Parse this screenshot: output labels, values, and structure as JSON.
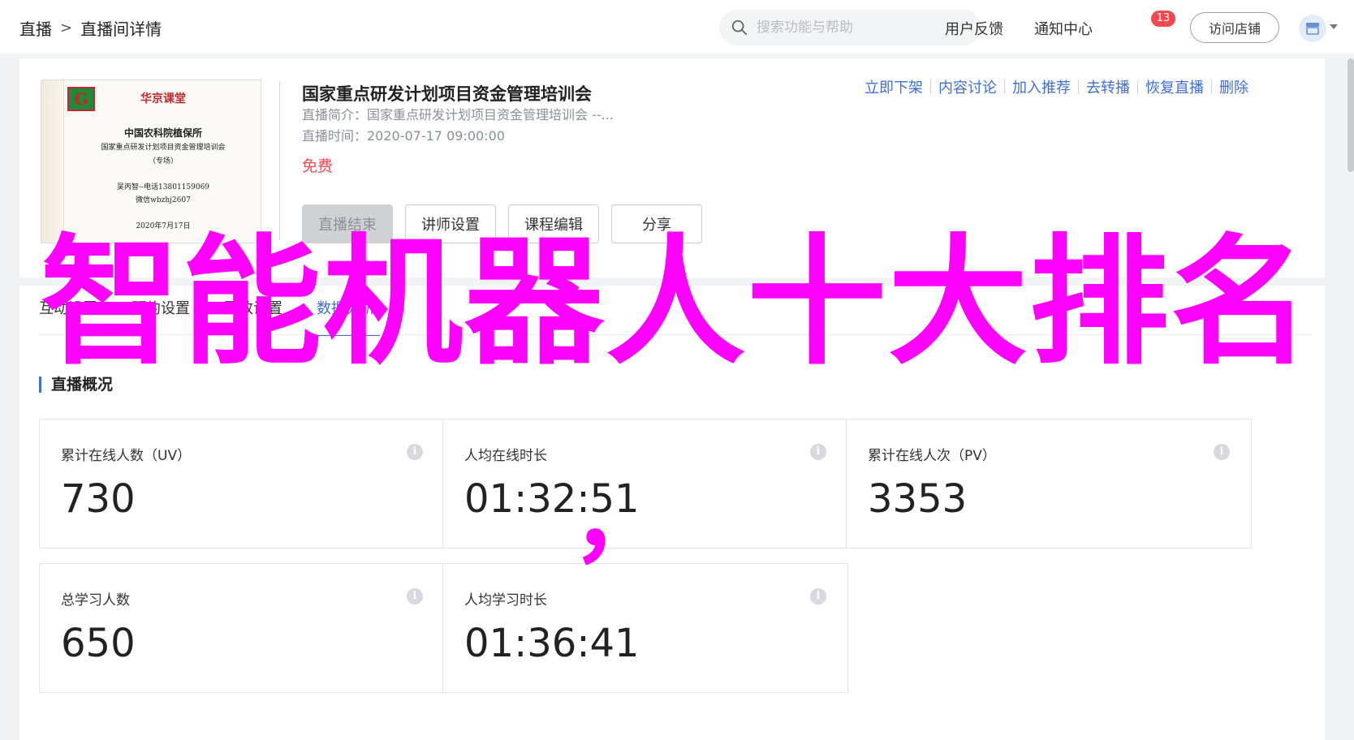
{
  "header": {
    "breadcrumb": [
      "直播",
      "直播间详情"
    ],
    "breadcrumb_sep": ">",
    "search_placeholder": "搜索功能与帮助",
    "feedback": "用户反馈",
    "notify": "通知中心",
    "notify_count": "13",
    "visit_store": "访问店铺"
  },
  "course": {
    "cover": {
      "brand": "华京课堂",
      "org": "中国农科院植保所",
      "line1": "国家重点研发计划项目资金管理培训会",
      "line2": "（专场）",
      "contact1": "吴丙智--电话13801159069",
      "contact2": "微信wbzhj2607",
      "date": "2020年7月17日"
    },
    "title": "国家重点研发计划项目资金管理培训会",
    "intro": "直播简介：国家重点研发计划项目资金管理培训会 --...",
    "time": "直播时间：2020-07-17 09:00:00",
    "price": "免费",
    "buttons": [
      "直播结束",
      "讲师设置",
      "课程编辑",
      "分享"
    ],
    "ops": [
      "立即下架",
      "内容讨论",
      "加入推荐",
      "去转播",
      "恢复直播",
      "删除"
    ]
  },
  "tabs": [
    "互动设置",
    "预约设置",
    "回放设置",
    "数据分析"
  ],
  "active_tab": 3,
  "overview": {
    "title": "直播概况",
    "stats": [
      {
        "label": "累计在线人数（UV）",
        "value": "730"
      },
      {
        "label": "人均在线时长",
        "value": "01:32:51"
      },
      {
        "label": "累计在线人次（PV）",
        "value": "3353"
      },
      {
        "label": "总学习人数",
        "value": "650"
      },
      {
        "label": "人均学习时长",
        "value": "01:36:41"
      }
    ]
  },
  "overlay": {
    "text": "智能机器人十大排名",
    "comma": "，"
  },
  "colors": {
    "accent": "#3f6fd6",
    "price": "#f5474f",
    "overlay": "#ff00ff"
  }
}
